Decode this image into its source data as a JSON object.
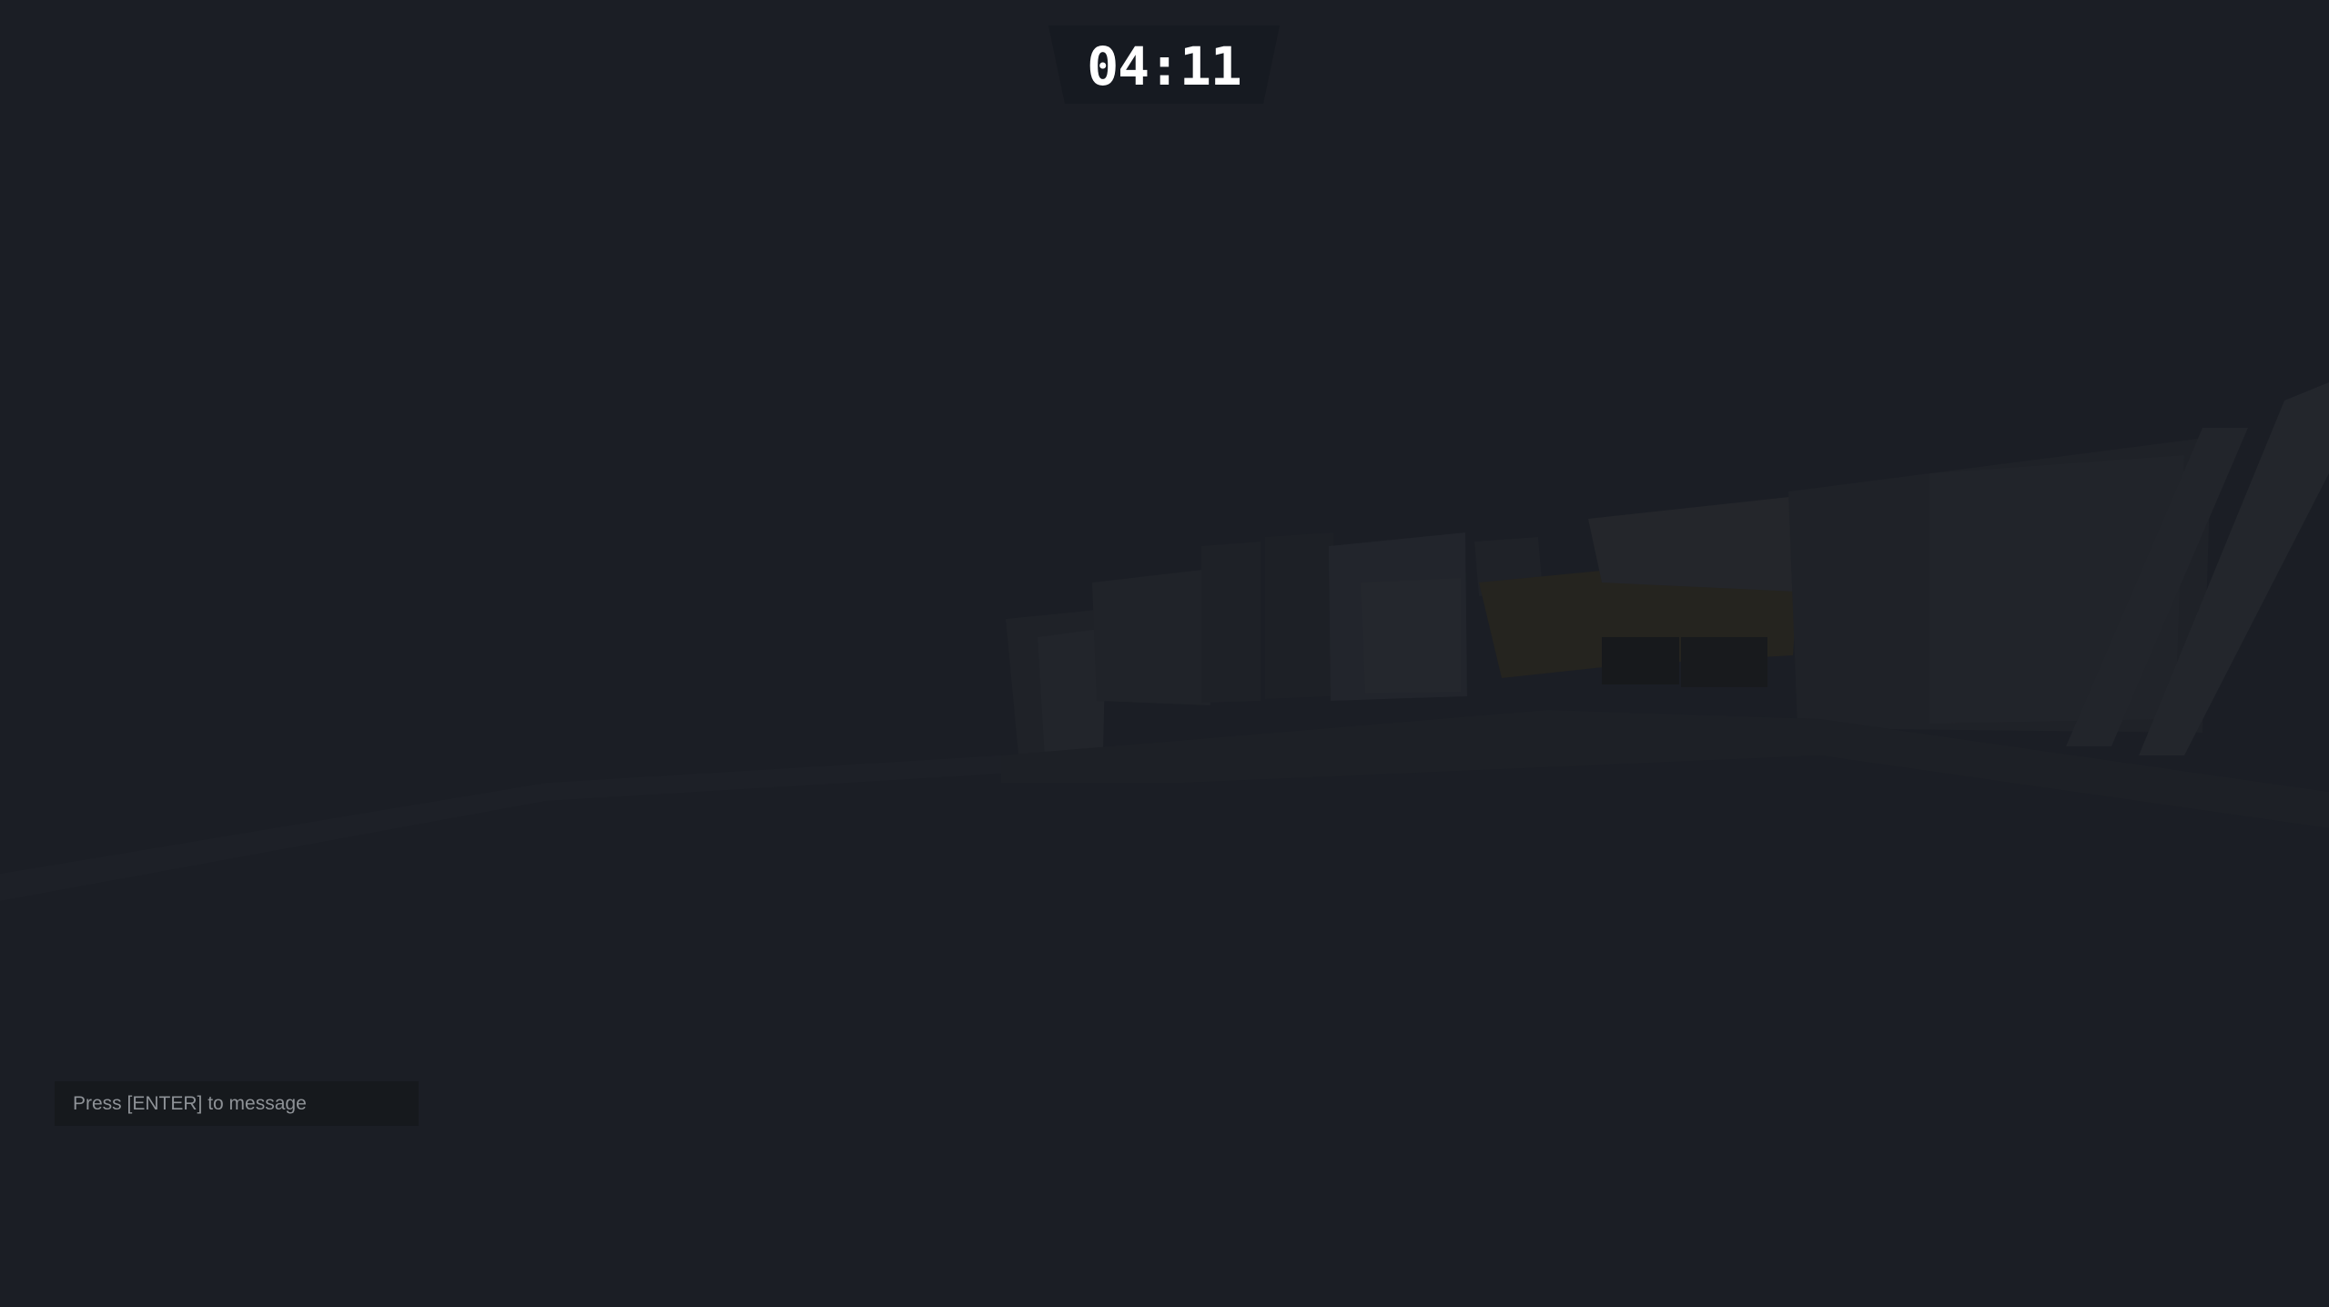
{
  "hud": {
    "timer": "04:11"
  },
  "chat": {
    "prompt": "Press [ENTER] to message"
  },
  "colors": {
    "background": "#1b1e25",
    "timer_plate": "#161a21",
    "timer_text": "#ffffff",
    "chat_box": "#16191d",
    "chat_text": "#8e9297"
  }
}
